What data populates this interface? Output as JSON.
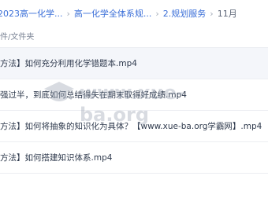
{
  "breadcrumb": {
    "items": [
      {
        "label": "2023高一化学..."
      },
      {
        "label": "高一化学全体系规..."
      },
      {
        "label": "2.规划服务"
      },
      {
        "label": "11月"
      }
    ],
    "separator": "›"
  },
  "column_header": "件/文件夹",
  "files": [
    {
      "name": "方法】如何充分利用化学错题本.mp4"
    },
    {
      "name": "强过半，到底如何总结得失在期末取得好成绩.mp4"
    },
    {
      "name": "方法】如何将抽象的知识化为具体？【www.xue-ba.org学霸网】.mp4"
    },
    {
      "name": "方法】如何搭建知识体系.mp4"
    }
  ],
  "watermark": {
    "text": "www.xue-ba.org"
  },
  "colors": {
    "link": "#3b6fd8",
    "hover_row": "#f4f6fa",
    "text": "#2f3a4d"
  }
}
